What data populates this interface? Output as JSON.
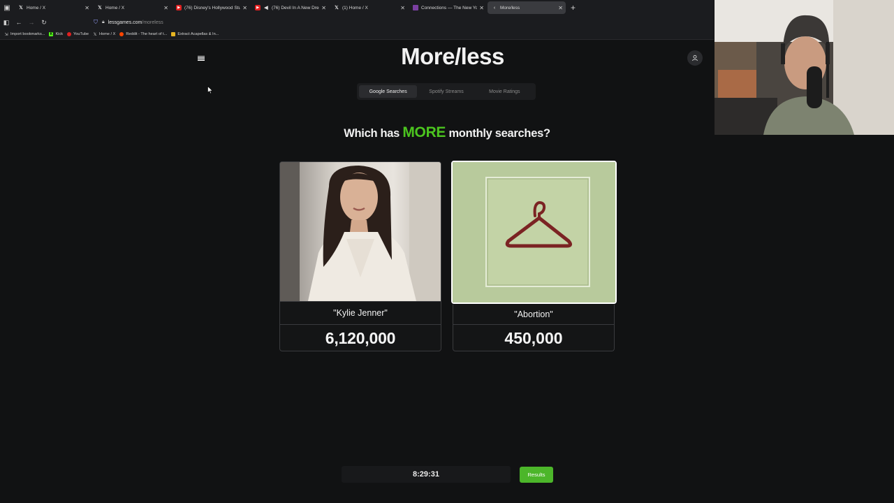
{
  "browser": {
    "tabs": [
      {
        "title": "Home / X",
        "icon": "x-logo-icon",
        "active": false
      },
      {
        "title": "Home / X",
        "icon": "x-logo-icon",
        "active": false
      },
      {
        "title": "(76) Disney's Hollywood Studio",
        "icon": "youtube-icon",
        "active": false
      },
      {
        "title": "(76) Devil In A New Dress",
        "icon": "speaker-icon",
        "active": false
      },
      {
        "title": "(1) Home / X",
        "icon": "x-logo-icon",
        "active": false
      },
      {
        "title": "Connections — The New York",
        "icon": "nyt-icon",
        "active": false
      },
      {
        "title": "More/less",
        "icon": "lessgames-icon",
        "active": true
      }
    ],
    "url_domain": "lessgames.com",
    "url_path": "/moreless",
    "bookmarks": [
      {
        "label": "Import bookmarks...",
        "icon": "import-icon"
      },
      {
        "label": "Kick",
        "icon": "kick-icon"
      },
      {
        "label": "YouTube",
        "icon": "youtube-icon"
      },
      {
        "label": "Home / X",
        "icon": "x-logo-icon"
      },
      {
        "label": "Reddit - The heart of t...",
        "icon": "reddit-icon"
      },
      {
        "label": "Extract Acapellas & In...",
        "icon": "folder-icon"
      }
    ]
  },
  "page": {
    "logo": "More/less",
    "game_tabs": [
      "Google Searches",
      "Spotify Streams",
      "Movie Ratings"
    ],
    "active_tab": 0,
    "question": {
      "prefix": "Which has ",
      "highlight": "MORE",
      "suffix": " monthly searches?"
    },
    "cards": [
      {
        "name": "\"Kylie Jenner\"",
        "value": "6,120,000",
        "selected": false
      },
      {
        "name": "\"Abortion\"",
        "value": "450,000",
        "selected": true
      }
    ],
    "timer": "8:29:31",
    "results_label": "Results",
    "colors": {
      "accent_green": "#4cc51f",
      "button_green": "#4cb62a",
      "background": "#111213"
    }
  }
}
